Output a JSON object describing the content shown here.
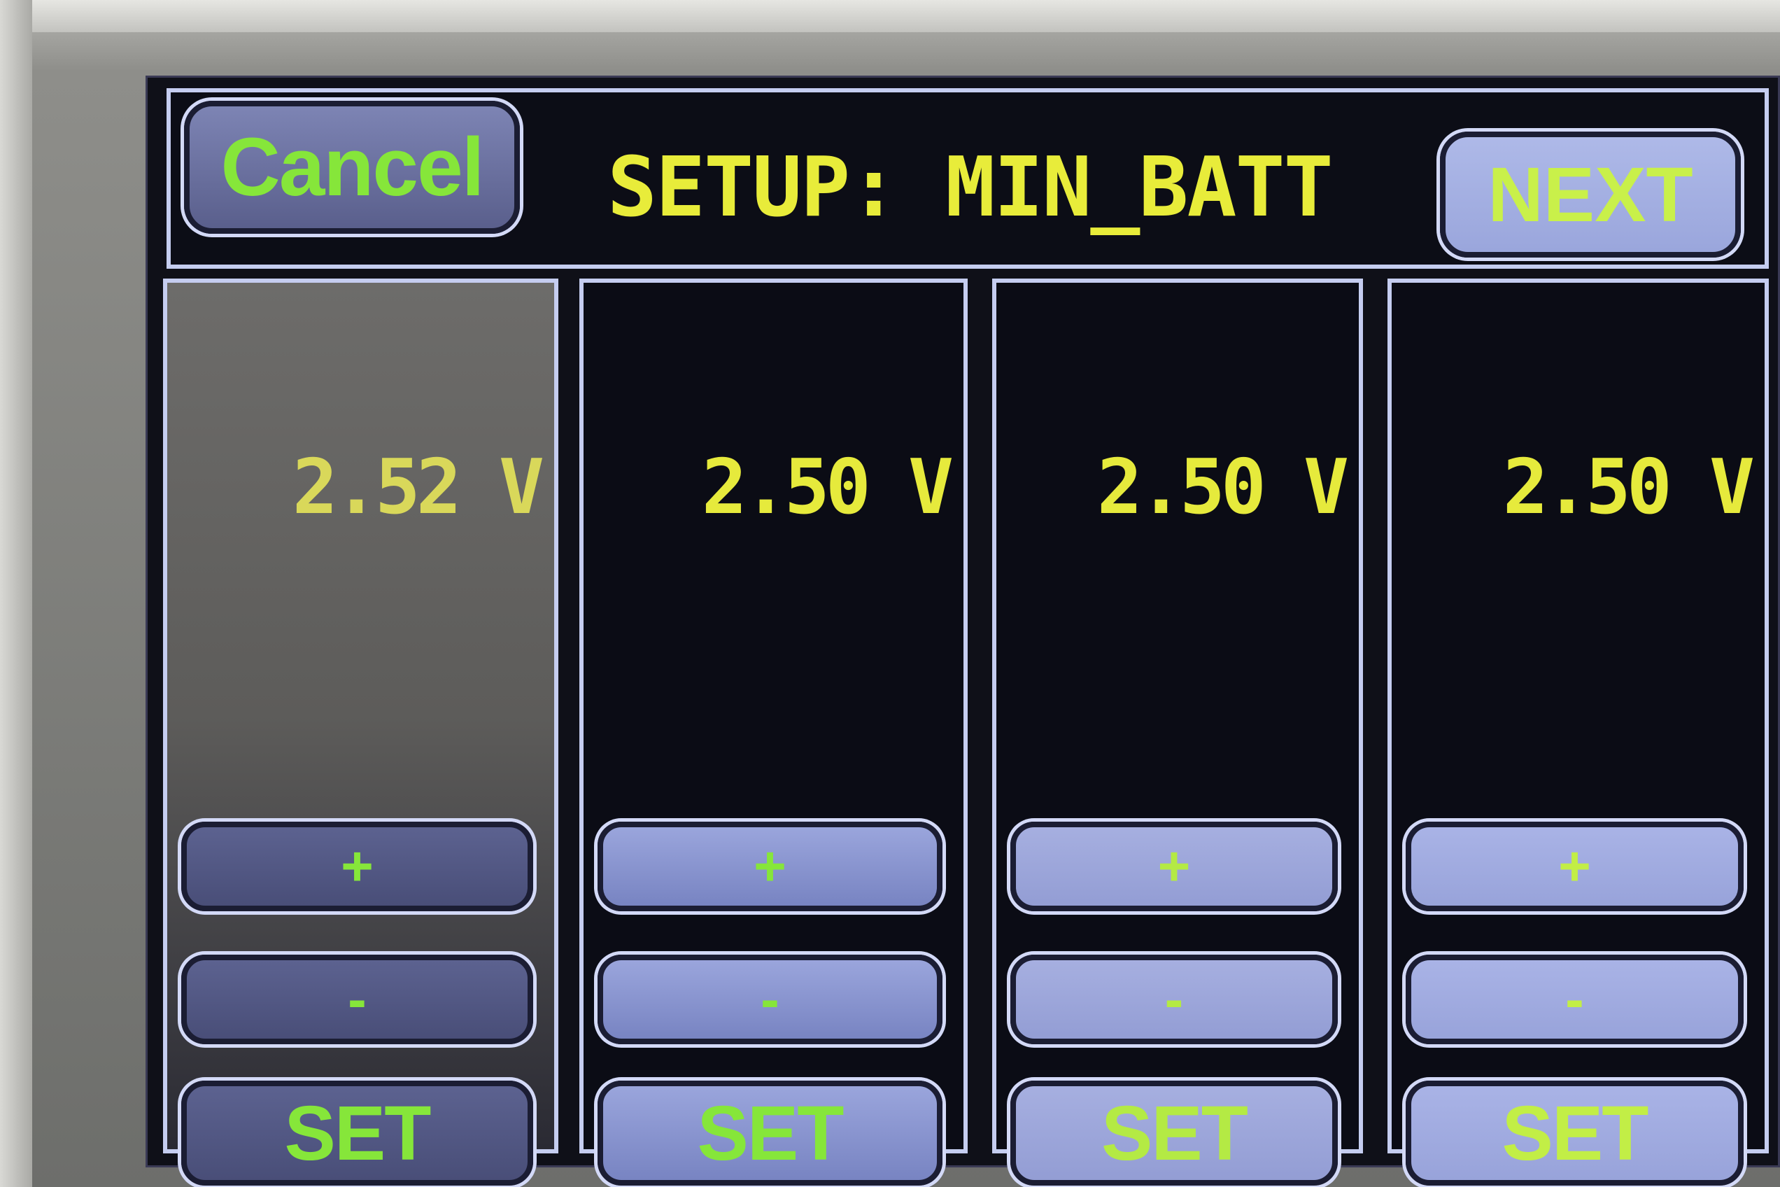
{
  "header": {
    "cancel_label": "Cancel",
    "title": "SETUP: MIN_BATT",
    "next_label": "NEXT"
  },
  "columns": [
    {
      "value": "2.52 V",
      "plus_label": "+",
      "minus_label": "-",
      "set_label": "SET"
    },
    {
      "value": "2.50 V",
      "plus_label": "+",
      "minus_label": "-",
      "set_label": "SET"
    },
    {
      "value": "2.50 V",
      "plus_label": "+",
      "minus_label": "-",
      "set_label": "SET"
    },
    {
      "value": "2.50 V",
      "plus_label": "+",
      "minus_label": "-",
      "set_label": "SET"
    }
  ],
  "colors": {
    "button_text": "#86e63a",
    "title_text": "#e8ec3a",
    "frame": "#c5cdf0",
    "screen_bg": "#0f1018"
  }
}
